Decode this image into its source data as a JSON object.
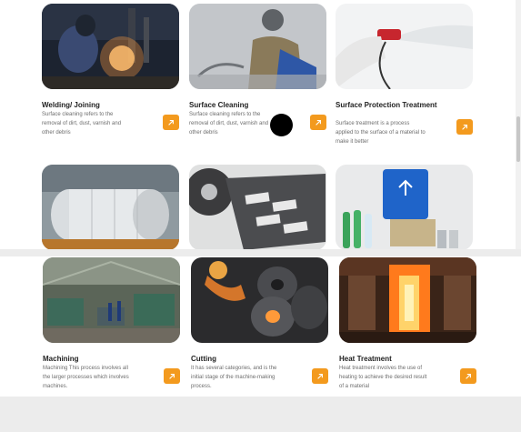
{
  "cards": [
    {
      "title": "Welding/ Joining",
      "desc": "Surface cleaning refers to the removal of dirt, dust, varnish and other debris",
      "image": "welding-photo"
    },
    {
      "title": "Surface Cleaning",
      "desc": "Surface cleaning refers to the removal of dirt, dust, varnish and other debris",
      "image": "surface-cleaning-photo"
    },
    {
      "title": "Surface Protection Treatment",
      "desc": "Surface treatment is a process applied to the surface of a material to make it better",
      "image": "spray-coating-photo"
    },
    {
      "title": "",
      "desc": "",
      "image": "wrapped-cylinders-photo"
    },
    {
      "title": "",
      "desc": "",
      "image": "labels-packaging-photo"
    },
    {
      "title": "",
      "desc": "",
      "image": "recycling-bottles-photo"
    },
    {
      "title": "Machining",
      "desc": "Machining This process involves all the larger processes which involves machines.",
      "image": "machine-shop-photo"
    },
    {
      "title": "Cutting",
      "desc": "It has several categories, and is the initial stage of the machine-making process.",
      "image": "steel-coils-photo"
    },
    {
      "title": "Heat Treatment",
      "desc": "Heat treatment involves the use of heating to achieve the desired result of a material",
      "image": "furnace-photo"
    }
  ],
  "colors": {
    "accent": "#f39a1e",
    "title": "#222222",
    "text": "#6d6d6d"
  },
  "icons": {
    "card_arrow": "arrow-up-right-icon"
  }
}
